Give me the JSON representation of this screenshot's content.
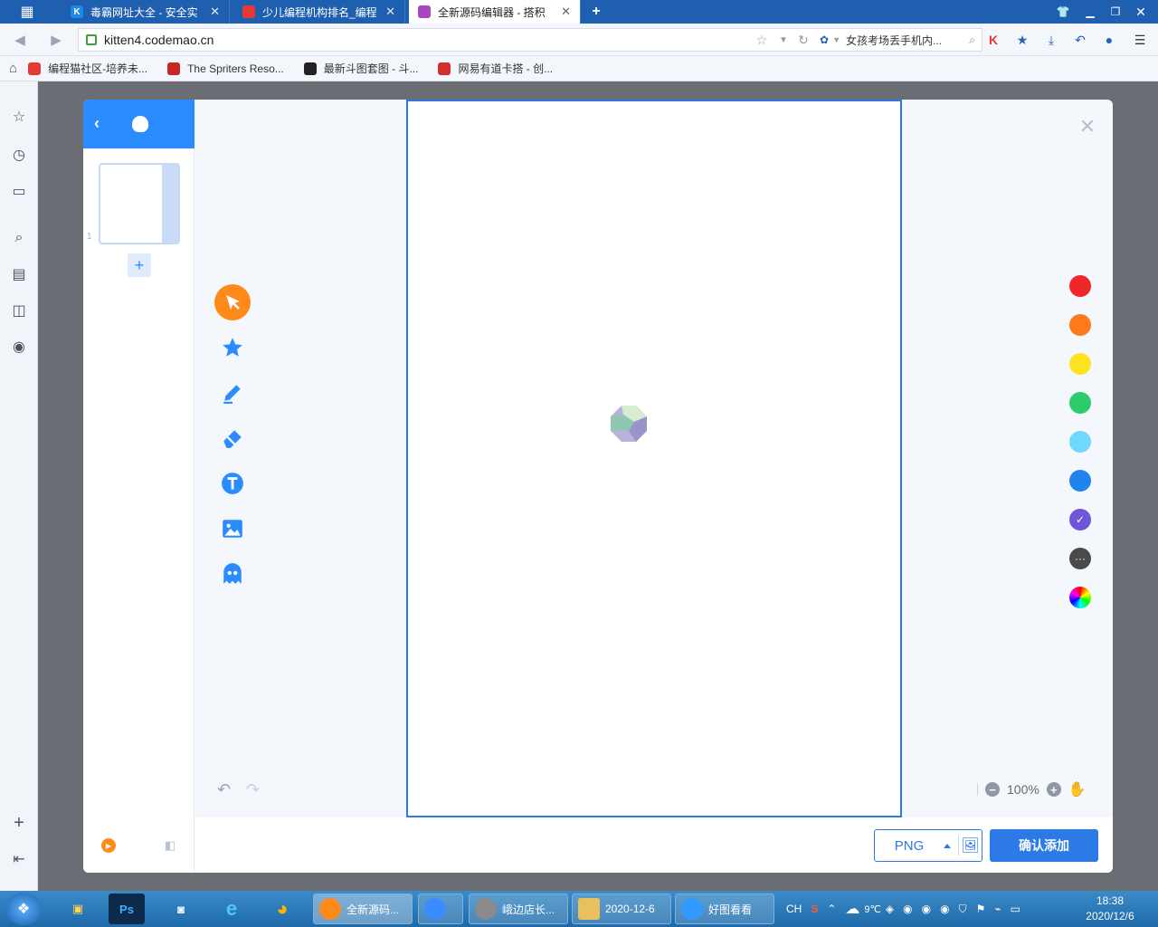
{
  "browser": {
    "tabs": [
      {
        "title": "毒霸网址大全 - 安全实",
        "icon_color": "#1e88e5",
        "icon_letter": "K"
      },
      {
        "title": "少儿编程机构排名_编程",
        "icon_color": "#e53935",
        "icon_letter": ""
      },
      {
        "title": "全新源码编辑器 - 搭积",
        "icon_color": "#ab47bc",
        "icon_letter": ""
      }
    ],
    "tab_close": "✕",
    "new_tab": "+",
    "url": "kitten4.codemao.cn",
    "search_text": "女孩考场丢手机内...",
    "bookmarks": [
      {
        "label": "编程猫社区-培养未...",
        "color": "#e53935"
      },
      {
        "label": "The Spriters Reso...",
        "color": "#c62828"
      },
      {
        "label": "最新斗图套图 - 斗...",
        "color": "#222222"
      },
      {
        "label": "网易有道卡搭 - 创...",
        "color": "#d32f2f"
      }
    ]
  },
  "dialog": {
    "frame_number": "1",
    "add_frame": "+",
    "zoom_level": "100%",
    "zoom_out": "−",
    "zoom_in": "+",
    "format": "PNG",
    "confirm_label": "确认添加",
    "close": "✕",
    "swatches": [
      {
        "color": "#f0262b",
        "selected": false
      },
      {
        "color": "#ff7a1a",
        "selected": false
      },
      {
        "color": "#ffe21f",
        "selected": false
      },
      {
        "color": "#2bcc6a",
        "selected": false
      },
      {
        "color": "#6ed8ff",
        "selected": false
      },
      {
        "color": "#1f84f0",
        "selected": false
      },
      {
        "color": "#6f55d9",
        "selected": true
      },
      {
        "color": "#4a4a4a",
        "selected": false
      },
      {
        "color": "rainbow",
        "selected": false
      }
    ],
    "tools": [
      "select-tool",
      "shape-tool",
      "brush-tool",
      "eraser-tool",
      "text-tool",
      "image-tool",
      "sprite-tool"
    ]
  },
  "taskbar": {
    "windows": [
      {
        "label": "全新源码...",
        "color": "#ff8a1c",
        "active": true
      },
      {
        "label": "",
        "color": "#3a8cff",
        "active": false
      },
      {
        "label": "峨边店长...",
        "color": "#8a8a8a",
        "active": false
      },
      {
        "label": "2020-12-6",
        "color": "#e8c15c",
        "active": false
      },
      {
        "label": "好图看看",
        "color": "#2f9bff",
        "active": false
      }
    ],
    "input_method": "CH",
    "weather": "9℃",
    "time": "18:38",
    "date": "2020/12/6"
  }
}
